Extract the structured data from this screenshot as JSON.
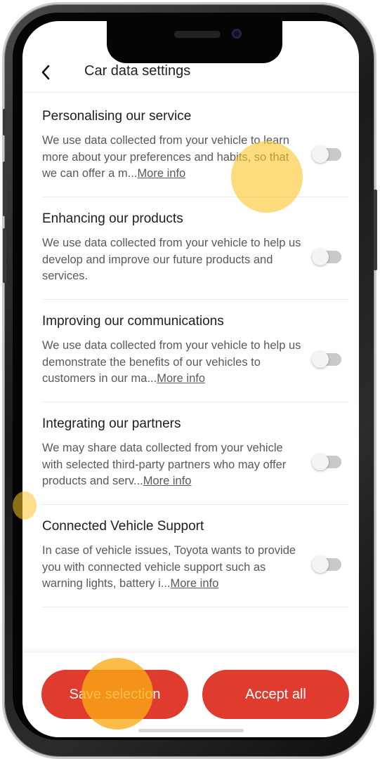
{
  "header": {
    "back_icon": "chevron-left-icon",
    "title": "Car data settings"
  },
  "settings": [
    {
      "title": "Personalising our service",
      "desc": "We use data collected from your vehicle to learn more about your preferences and habits, so that we can offer a m...",
      "link": "More info",
      "enabled": false
    },
    {
      "title": "Enhancing our products",
      "desc": "We use data collected from your vehicle to help us develop and improve our future products and services.",
      "link": "",
      "enabled": false
    },
    {
      "title": "Improving our communications",
      "desc": "We use data collected from your vehicle to help us demonstrate the benefits of our vehicles to customers in our ma...",
      "link": "More info",
      "enabled": false
    },
    {
      "title": "Integrating our partners",
      "desc": "We may share data collected from your vehicle with selected third-party partners who may offer products and serv...",
      "link": "More info",
      "enabled": false
    },
    {
      "title": "Connected Vehicle Support",
      "desc": "In case of vehicle issues, Toyota wants to provide you with connected vehicle support such as warning lights, battery i...",
      "link": "More info",
      "enabled": false
    }
  ],
  "footer": {
    "save_label": "Save selection",
    "accept_label": "Accept all"
  },
  "colors": {
    "accent": "#e03b2f",
    "toggle_off": "#c9c9c9",
    "touch_indicator": "#fcc428"
  }
}
